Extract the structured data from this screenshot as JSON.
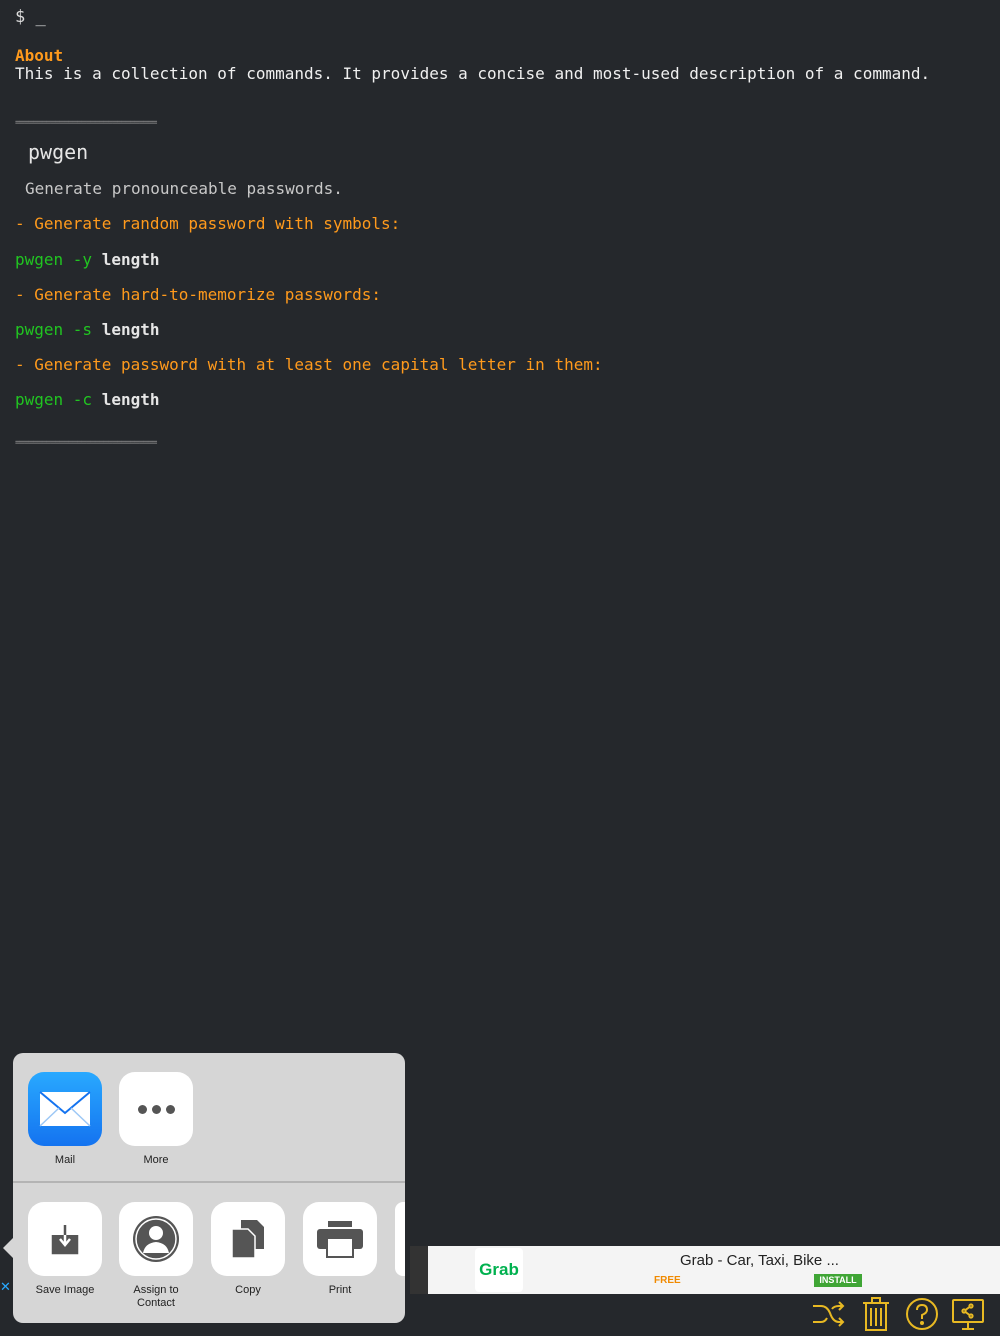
{
  "terminal": {
    "prompt": "$ _",
    "about_heading": "About",
    "about_text": "This is a collection of commands. It provides a concise and most-used description of a command.",
    "separator": "================================"
  },
  "page": {
    "title": "pwgen",
    "description": "Generate pronounceable passwords.",
    "examples": [
      {
        "desc": "- Generate random password with symbols:",
        "cmd": "pwgen -y",
        "arg": "length"
      },
      {
        "desc": "- Generate hard-to-memorize passwords:",
        "cmd": "pwgen -s",
        "arg": "length"
      },
      {
        "desc": "- Generate password with at least one capital letter in them:",
        "cmd": "pwgen -c",
        "arg": "length"
      }
    ]
  },
  "share_sheet": {
    "row1": [
      {
        "label": "Mail",
        "icon": "mail-icon"
      },
      {
        "label": "More",
        "icon": "more-icon"
      }
    ],
    "row2": [
      {
        "label": "Save Image",
        "icon": "save-image-icon"
      },
      {
        "label": "Assign to Contact",
        "icon": "contact-icon"
      },
      {
        "label": "Copy",
        "icon": "copy-icon"
      },
      {
        "label": "Print",
        "icon": "print-icon"
      }
    ]
  },
  "ad": {
    "logo": "Grab",
    "title": "Grab - Car, Taxi, Bike ...",
    "price": "FREE",
    "install": "INSTALL",
    "close": "✕"
  },
  "toolbar": {
    "icons": [
      "shuffle-icon",
      "trash-icon",
      "help-icon",
      "share-icon"
    ],
    "accent_color": "#e8b923"
  },
  "colors": {
    "background": "#25282c",
    "heading": "#ff9a1c",
    "command": "#21c521"
  }
}
